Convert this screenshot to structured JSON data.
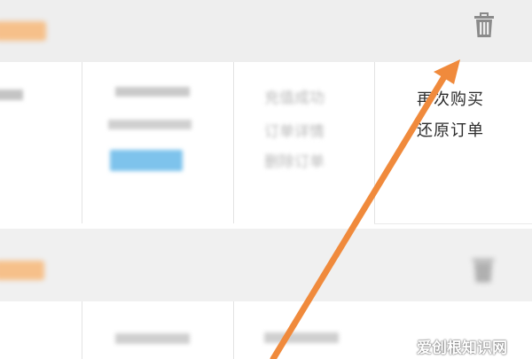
{
  "order_card_1": {
    "status_text": "充值成功",
    "details_link": "订单详情",
    "delete_link": "删除订单",
    "buy_again_label": "再次购买",
    "restore_label": "还原订单"
  },
  "watermark": {
    "text": "爱创根知识网"
  },
  "colors": {
    "header_band": "#eeeeee",
    "orange_tag": "#f6c08a",
    "blue_tag": "#7ec3ec",
    "arrow": "#f08a3c"
  },
  "icons": {
    "delete": "trash-icon"
  }
}
